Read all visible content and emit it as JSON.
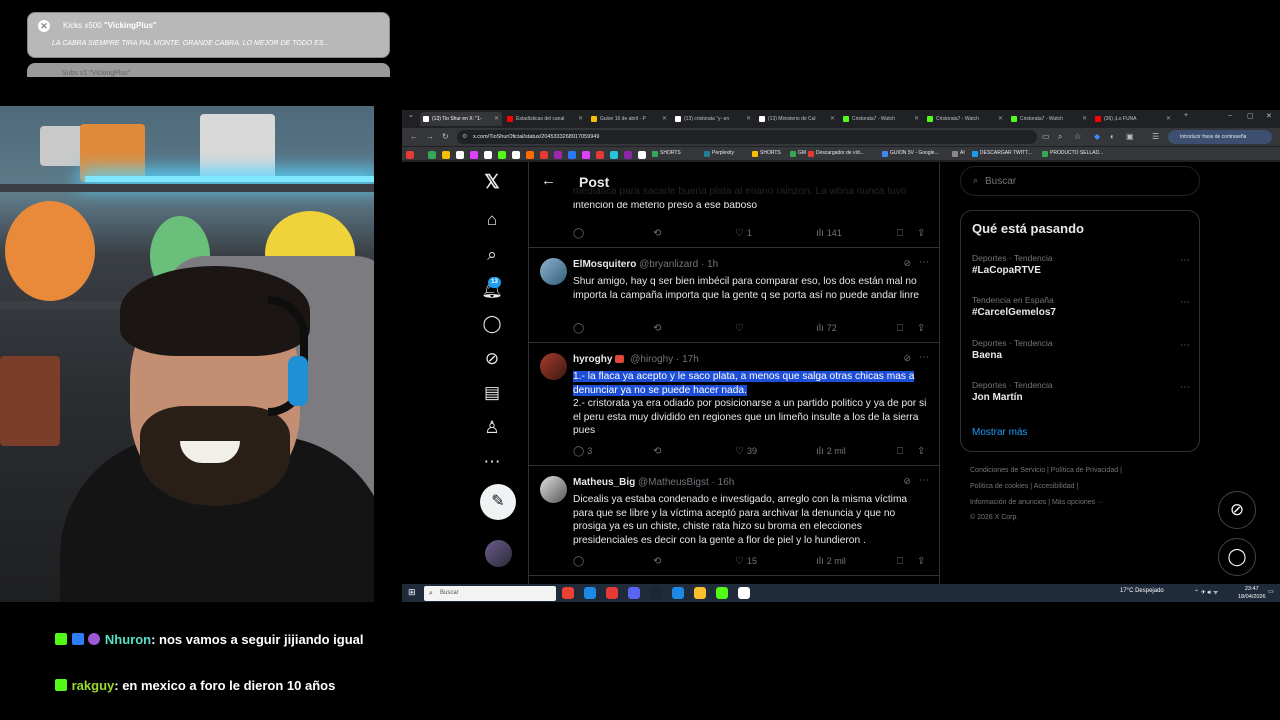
{
  "alert": {
    "title": "Kicks x500 ",
    "user": "\"VickingPlus\"",
    "message": "LA CABRA SIEMPRE TIRA PAL MONTE. GRANDE CABRA. LO MEJOR DE TODO ES...",
    "second_title": "Subs x1 \"VickingPlus\""
  },
  "chat": {
    "messages": [
      {
        "user": "Nhuron",
        "user_color": "#57e0c5",
        "text": ": nos vamos a seguir jijiando igual"
      },
      {
        "user": "rakguy",
        "user_color": "#9adb2b",
        "text": ": en mexico a foro le dieron 10 años"
      }
    ]
  },
  "browser": {
    "tabs": [
      {
        "label": "(13) Tio Shur en X: \"1-",
        "color": "#ffffff",
        "active": true
      },
      {
        "label": "Estadísticas del canal",
        "color": "#ff0000"
      },
      {
        "label": "Guion 16 de abril - P",
        "color": "#fbbc04"
      },
      {
        "label": "(13) cristorata \"y- en",
        "color": "#ffffff"
      },
      {
        "label": "(13) Ministerio de Cul",
        "color": "#ffffff"
      },
      {
        "label": "Cristorata7 - Watch",
        "color": "#53fc18"
      },
      {
        "label": "Cristorata7 - Watch",
        "color": "#53fc18"
      },
      {
        "label": "Cristorata7 - Watch",
        "color": "#53fc18"
      },
      {
        "label": "(36) ¡Lo FUNA",
        "color": "#ff0000"
      }
    ],
    "url": "x.com/TioShurOficial/status/2045333268917059949",
    "password_pill": "Introducir frase de contraseña",
    "bookmarks": [
      {
        "label": "SHORTS",
        "color": "#34a853"
      },
      {
        "label": "Perplexity",
        "color": "#20808d"
      },
      {
        "label": "SHORTS",
        "color": "#fbbc04"
      },
      {
        "label": "GM",
        "color": "#34a853"
      },
      {
        "label": "Descargador de víd...",
        "color": "#e53935"
      },
      {
        "label": "GUION 5V - Google...",
        "color": "#4285f4"
      },
      {
        "label": "AI",
        "color": "#888888"
      },
      {
        "label": "DESCARGAR TWITT...",
        "color": "#1d9bf0"
      },
      {
        "label": "PRODUCTO SELLAD...",
        "color": "#34a853"
      }
    ]
  },
  "x": {
    "nav_badge": "13",
    "header_title": "Post",
    "partial_tweet": {
      "text": "mediática para sacarle buena plata al enano rainzon. La wbna nunca tuvo intencion de meterlo preso a ese baboso",
      "replies": "",
      "likes": "1",
      "views": "141"
    },
    "tweets": [
      {
        "name": "ElMosquitero",
        "handle": "@bryanlizard",
        "time": "· 1h",
        "text": "Shur amigo, hay q ser bien imbécil para comparar eso, los dos están mal no importa la campaña importa que la gente q se porta así no puede andar linre",
        "highlight": "",
        "replies": "",
        "likes": "",
        "views": "72"
      },
      {
        "name": "hyroghy",
        "handle": "@hiroghy",
        "time": "· 17h",
        "highlight": "1.- la flaca ya acepto y le saco plata, a menos que salga otras chicas mas a denunciar ya no se puede hacer nada.",
        "text": "2.- cristorata ya era odiado por posicionarse a un partido politico y ya de por si el peru esta muy dividido en regiones que un limeño insulte a los de la sierra pues",
        "replies": "3",
        "likes": "39",
        "views": "2 mil"
      },
      {
        "name": "Matheus_Big",
        "handle": "@MatheusBigst",
        "time": "· 16h",
        "highlight": "",
        "text": "Dicealis ya estaba condenado e investigado, arreglo con la misma víctima para que se libre y la víctima aceptó  para archivar la denuncia y que no prosiga ya es un chiste, chiste rata hizo su broma en elecciones presidenciales es decir con la gente a flor de piel y lo hundieron .",
        "replies": "",
        "likes": "15",
        "views": "2 mil"
      }
    ],
    "search_placeholder": "Buscar",
    "trends_title": "Qué está pasando",
    "trends": [
      {
        "context": "Deportes · Tendencia",
        "name": "#LaCopaRTVE"
      },
      {
        "context": "Tendencia en España",
        "name": "#CarcelGemelos7"
      },
      {
        "context": "Deportes · Tendencia",
        "name": "Baena"
      },
      {
        "context": "Deportes · Tendencia",
        "name": "Jon Martín"
      }
    ],
    "show_more": "Mostrar más",
    "footer": [
      "Condiciones de Servicio  |  Política de Privacidad  |",
      "Política de cookies  |  Accesibilidad  |",
      "Información de anuncios  |  Más opciones ···",
      "© 2026 X Corp."
    ]
  },
  "taskbar": {
    "search_placeholder": "Buscar",
    "weather": "17°C  Despejado",
    "time": "23:47",
    "date": "18/04/2026"
  }
}
